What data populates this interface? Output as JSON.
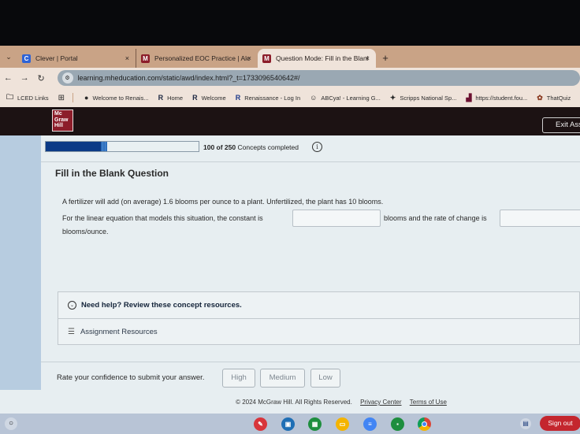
{
  "browser": {
    "tabs": [
      {
        "label": "Clever | Portal",
        "favicon": "C",
        "favicon_color": "#2e63d6",
        "active": false
      },
      {
        "label": "Personalized EOC Practice | Alc",
        "favicon": "M",
        "favicon_color": "#8c1d2a",
        "active": false
      },
      {
        "label": "Question Mode: Fill in the Blanl",
        "favicon": "M",
        "favicon_color": "#8c1d2a",
        "active": true
      }
    ],
    "new_tab": "+",
    "close_glyph": "×",
    "url": "learning.mheducation.com/static/awd/index.html?_t=1733096540642#/",
    "bookmarks": [
      {
        "label": "LCED Links",
        "icon": "folder-icon"
      },
      {
        "label": "Welcome to Renais...",
        "icon": "globe-icon"
      },
      {
        "label": "Home",
        "icon": "renaissance-icon"
      },
      {
        "label": "Welcome",
        "icon": "renaissance-icon"
      },
      {
        "label": "Renaissance - Log In",
        "icon": "renaissance-icon"
      },
      {
        "label": "ABCya! - Learning G...",
        "icon": "abcya-icon"
      },
      {
        "label": "Scripps National Sp...",
        "icon": "scripps-icon"
      },
      {
        "label": "https://student.fou...",
        "icon": "chart-icon"
      },
      {
        "label": "ThatQuiz",
        "icon": "thatquiz-icon"
      }
    ]
  },
  "header": {
    "logo_lines": [
      "Mc",
      "Graw",
      "Hill"
    ],
    "exit_label": "Exit Assi"
  },
  "progress": {
    "completed": 100,
    "total": 250,
    "fraction": 0.4,
    "count_text": "100 of 250",
    "suffix": "Concepts completed"
  },
  "question": {
    "title": "Fill in the Blank Question",
    "line1": "A fertilizer will add (on average) 1.6 blooms per ounce to a plant. Unfertilized, the plant has 10 blooms.",
    "line2_part1": "For the linear equation that models this situation, the constant is",
    "line2_part2": "blooms and the rate of change is",
    "line3": "blooms/ounce.",
    "blank1_value": "",
    "blank2_value": ""
  },
  "help": {
    "toggle_label": "Need help? Review these concept resources.",
    "resources_label": "Assignment Resources"
  },
  "confidence": {
    "prompt": "Rate your confidence to submit your answer.",
    "options": [
      "High",
      "Medium",
      "Low"
    ]
  },
  "footer": {
    "copyright": "© 2024 McGraw Hill. All Rights Reserved.",
    "privacy": "Privacy Center",
    "terms": "Terms of Use"
  },
  "shelf": {
    "apps": [
      {
        "name": "paint-app",
        "color": "#d8353b",
        "glyph": "✎"
      },
      {
        "name": "classroom-screen-app",
        "color": "#1f6fb5",
        "glyph": "▣"
      },
      {
        "name": "sheets-app",
        "color": "#1e8e3e",
        "glyph": "▦"
      },
      {
        "name": "slides-app",
        "color": "#f4b400",
        "glyph": "▭"
      },
      {
        "name": "docs-app",
        "color": "#4285f4",
        "glyph": "≡"
      },
      {
        "name": "classroom-app",
        "color": "#1e8e3e",
        "glyph": "▪"
      },
      {
        "name": "chrome-app",
        "color": "#db4437",
        "glyph": "◉"
      }
    ],
    "sign_out": "Sign out"
  }
}
